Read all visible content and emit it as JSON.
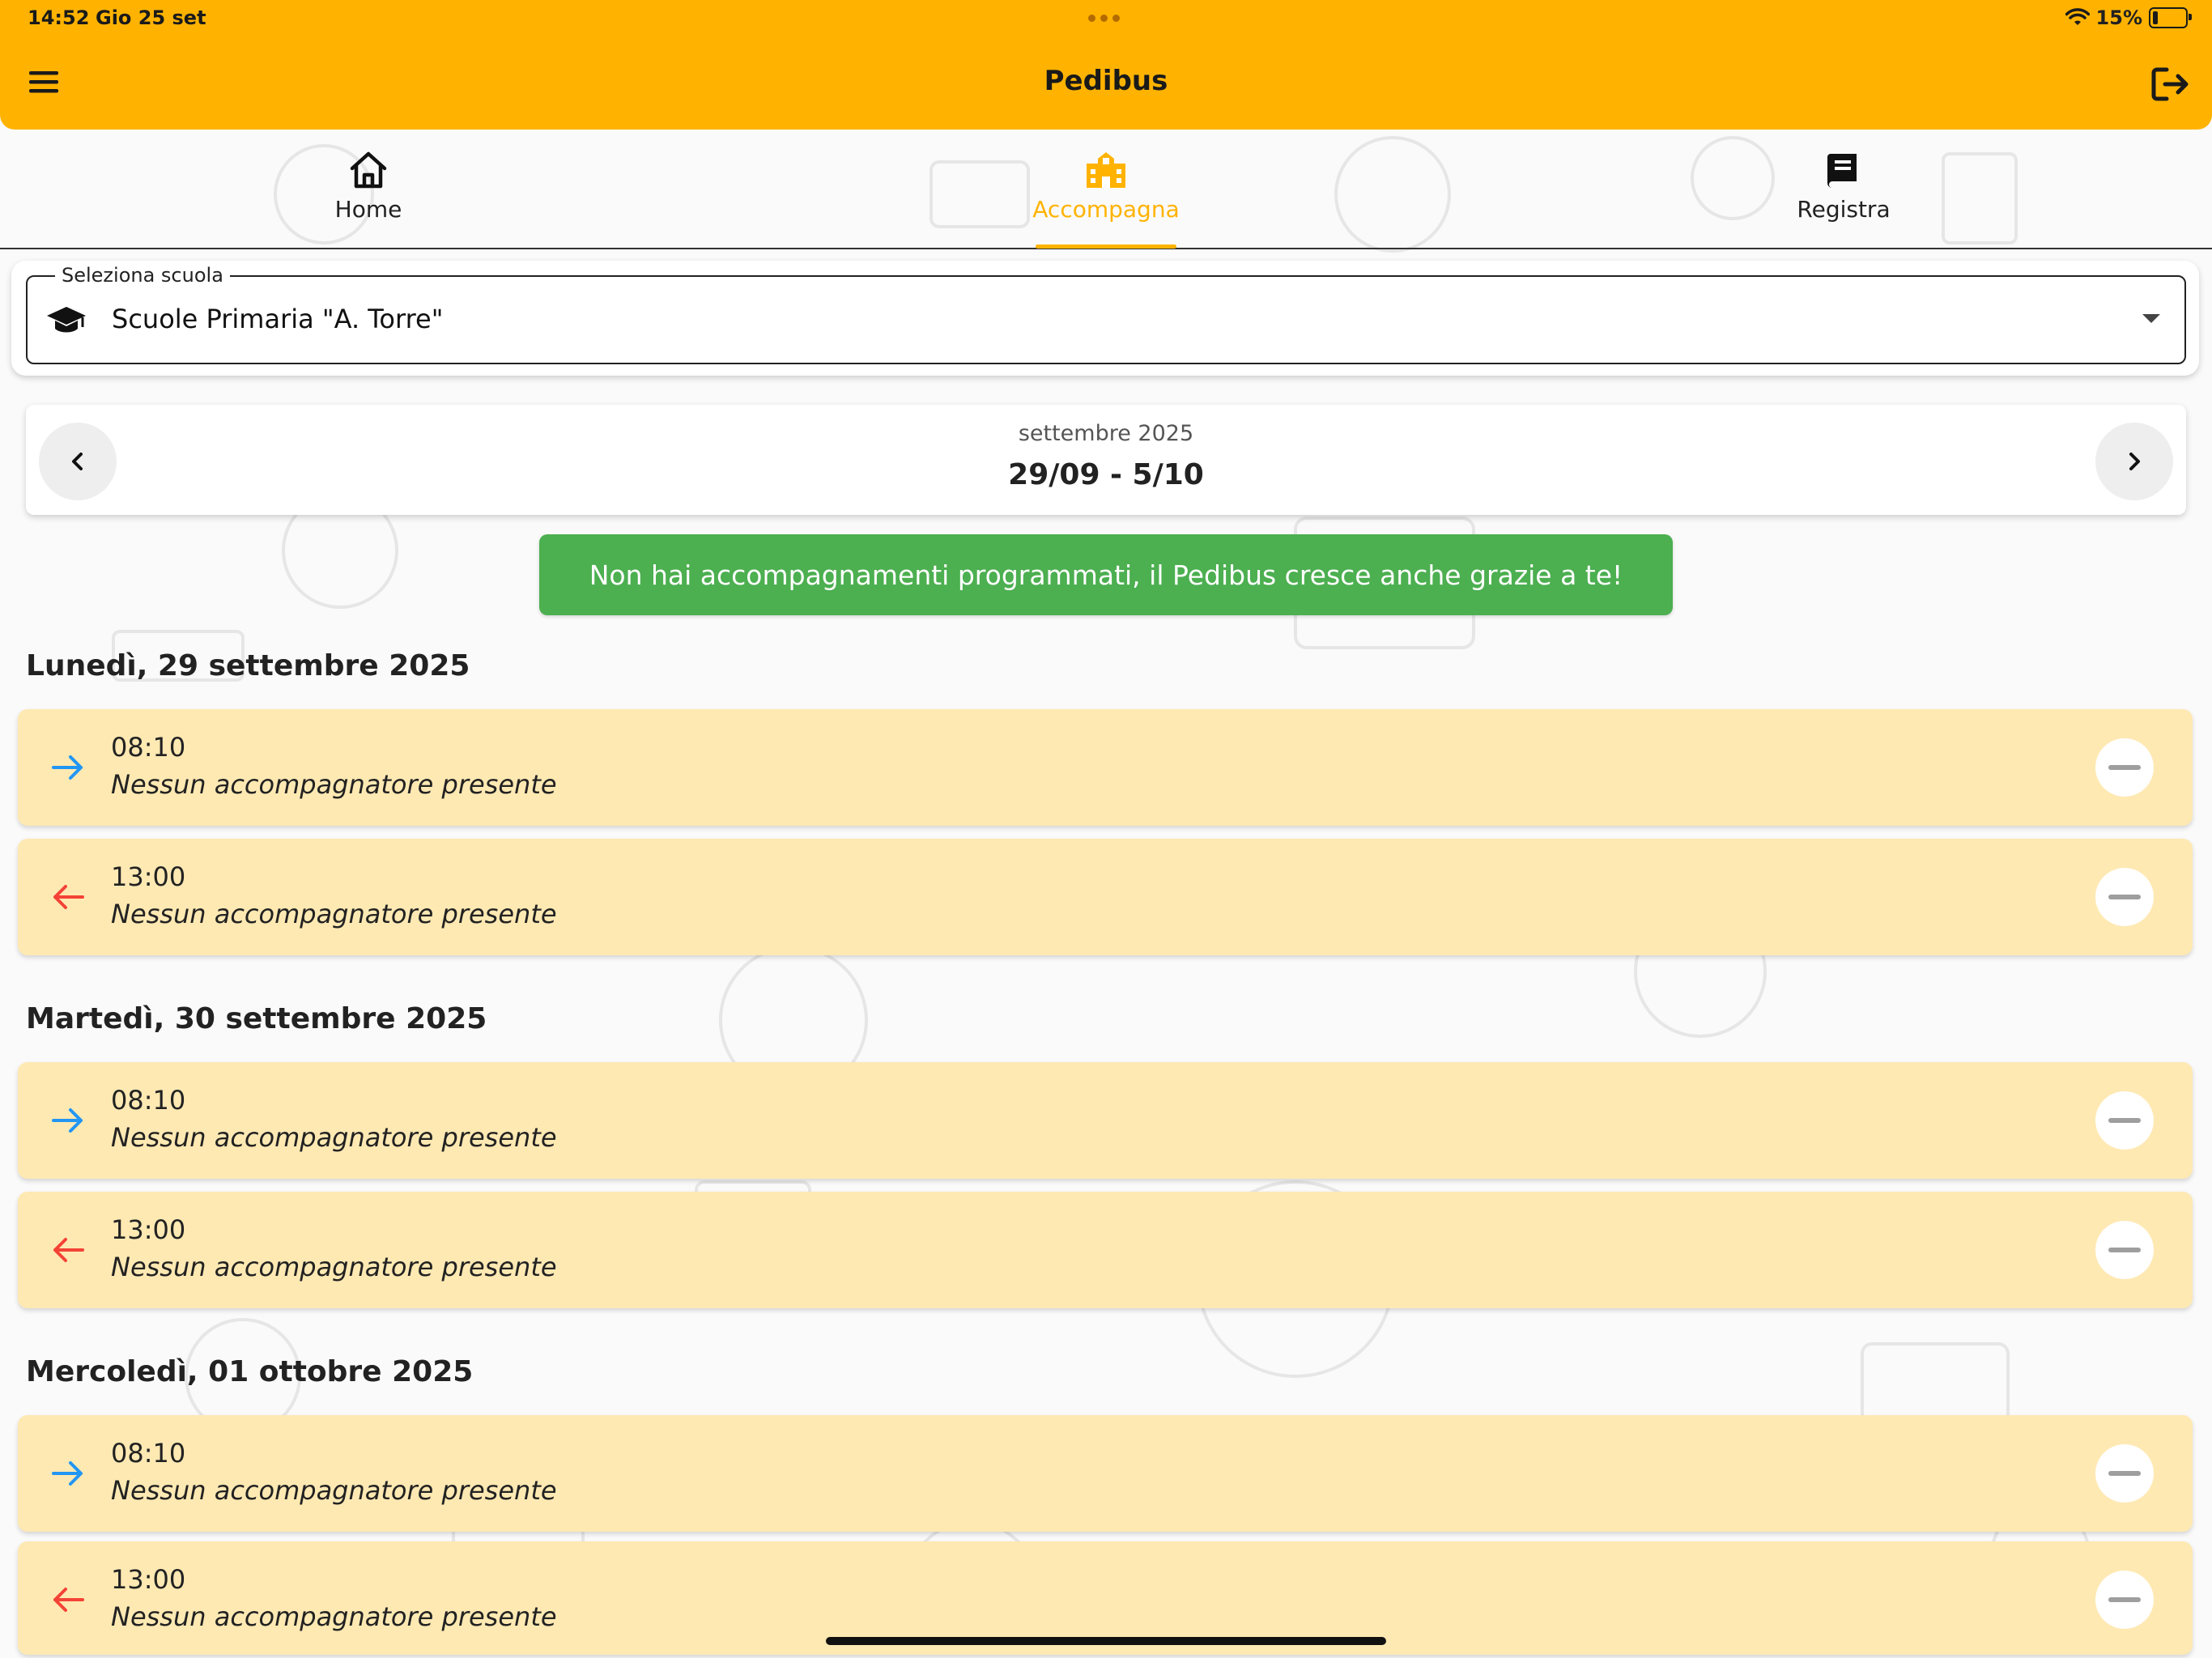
{
  "status_bar": {
    "time": "14:52",
    "date": "Gio 25 set",
    "battery": "15%"
  },
  "app_bar": {
    "title": "Pedibus"
  },
  "tabs": [
    {
      "label": "Home",
      "icon": "home-icon"
    },
    {
      "label": "Accompagna",
      "icon": "school-building-icon",
      "active": true
    },
    {
      "label": "Registra",
      "icon": "book-icon"
    }
  ],
  "school_select": {
    "legend": "Seleziona scuola",
    "value": "Scuole Primaria \"A. Torre\""
  },
  "week": {
    "month": "settembre 2025",
    "range": "29/09 - 5/10"
  },
  "notice": "Non hai accompagnamenti programmati, il Pedibus cresce anche grazie a te!",
  "days": [
    {
      "title": "Lunedì, 29 settembre 2025",
      "slots": [
        {
          "direction": "andata",
          "time": "08:10",
          "status": "Nessun accompagnatore presente"
        },
        {
          "direction": "ritorno",
          "time": "13:00",
          "status": "Nessun accompagnatore presente"
        }
      ]
    },
    {
      "title": "Martedì, 30 settembre 2025",
      "slots": [
        {
          "direction": "andata",
          "time": "08:10",
          "status": "Nessun accompagnatore presente"
        },
        {
          "direction": "ritorno",
          "time": "13:00",
          "status": "Nessun accompagnatore presente"
        }
      ]
    },
    {
      "title": "Mercoledì, 01 ottobre 2025",
      "slots": [
        {
          "direction": "andata",
          "time": "08:10",
          "status": "Nessun accompagnatore presente"
        },
        {
          "direction": "ritorno",
          "time": "13:00",
          "status": "Nessun accompagnatore presente"
        }
      ]
    }
  ],
  "colors": {
    "primary": "#ffb300",
    "slot_bg": "#ffe9b3",
    "notice_bg": "#4caf50",
    "arrow_in": "#2196f3",
    "arrow_out": "#f44336"
  }
}
